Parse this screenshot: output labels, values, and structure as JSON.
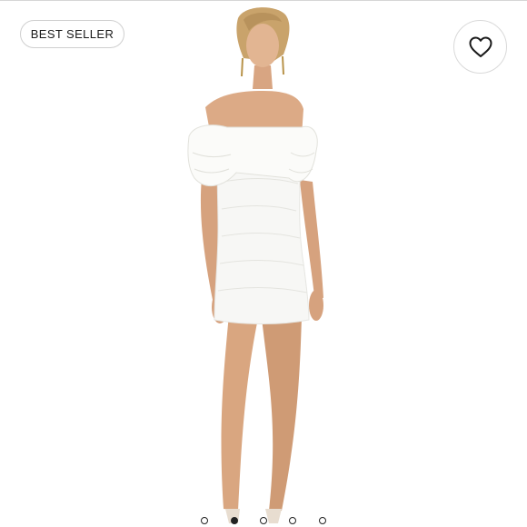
{
  "listing": {
    "badge_label": "BEST SELLER",
    "like_icon": "heart-outline-icon",
    "photo_subject": "model-in-white-off-shoulder-mini-dress",
    "carousel": {
      "total_slides": 5,
      "active_index": 1
    }
  },
  "colors": {
    "badge_border": "#cfcfcf",
    "text": "#1a1a1a",
    "dress": "#f7f7f5",
    "skin": "#dcaa86",
    "hair": "#c9a36b",
    "dot_active": "#222222"
  }
}
